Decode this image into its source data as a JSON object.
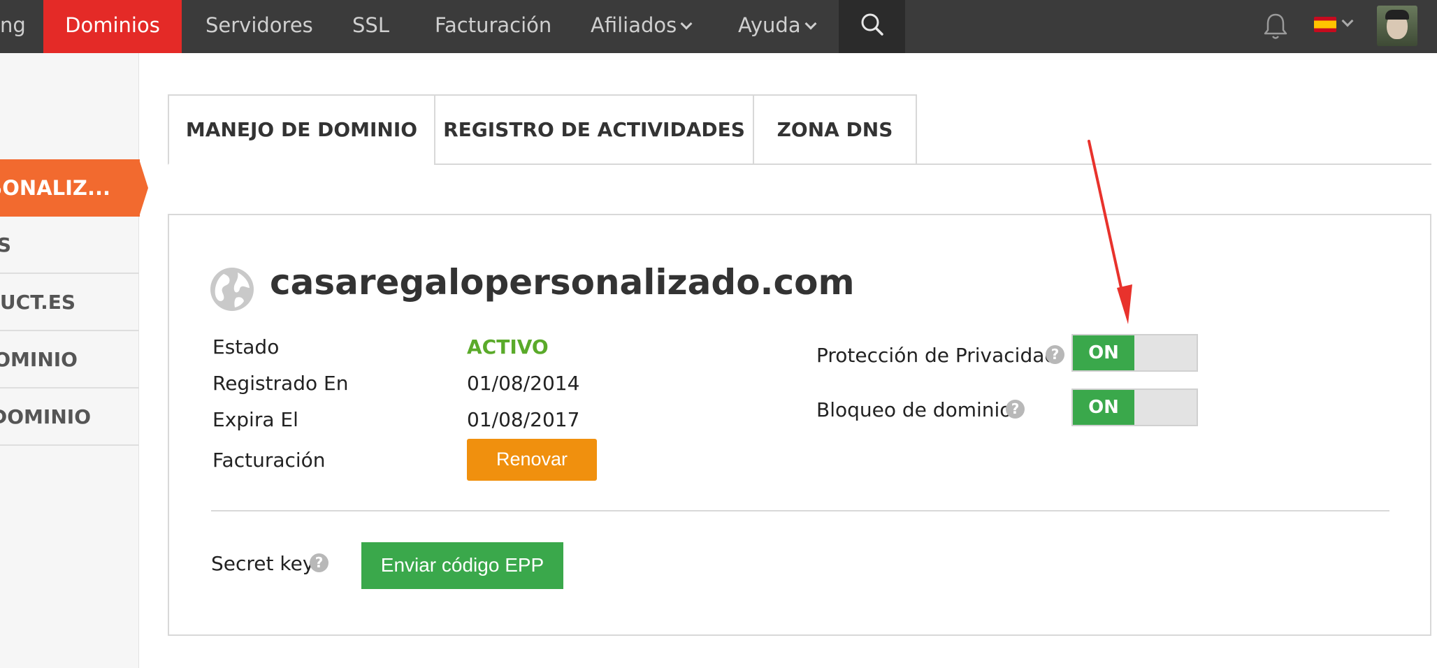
{
  "nav": {
    "partial_first": "ng",
    "items": [
      {
        "label": "Dominios"
      },
      {
        "label": "Servidores"
      },
      {
        "label": "SSL"
      },
      {
        "label": "Facturación"
      },
      {
        "label": "Afiliados"
      },
      {
        "label": "Ayuda"
      }
    ],
    "accent_color": "#e42a27"
  },
  "sidebar": {
    "active_label": "RSONALIZ...",
    "items": [
      {
        "label": "S"
      },
      {
        "label": "RUCT.ES"
      },
      {
        "label": "OMINIO"
      },
      {
        "label": "DOMINIO"
      }
    ],
    "active_color": "#f26a2f"
  },
  "tabs": [
    {
      "label": "MANEJO DE DOMINIO"
    },
    {
      "label": "REGISTRO DE ACTIVIDADES"
    },
    {
      "label": "ZONA DNS"
    }
  ],
  "domain": {
    "name": "casaregalopersonalizado.com",
    "fields": [
      {
        "label": "Estado",
        "value": "ACTIVO"
      },
      {
        "label": "Registrado En",
        "value": "01/08/2014"
      },
      {
        "label": "Expira El",
        "value": "01/08/2017"
      },
      {
        "label": "Facturación",
        "button": "Renovar"
      }
    ],
    "settings": [
      {
        "label": "Protección de Privacidad",
        "state": "ON"
      },
      {
        "label": "Bloqueo de dominio",
        "state": "ON"
      }
    ],
    "secret_key_label": "Secret key",
    "epp_button": "Enviar código EPP",
    "help_glyph": "?"
  },
  "colors": {
    "status_active": "#5aaa2a",
    "renew_button": "#f0900e",
    "toggle_on": "#3aa84b",
    "annotation_arrow": "#e8322c"
  }
}
